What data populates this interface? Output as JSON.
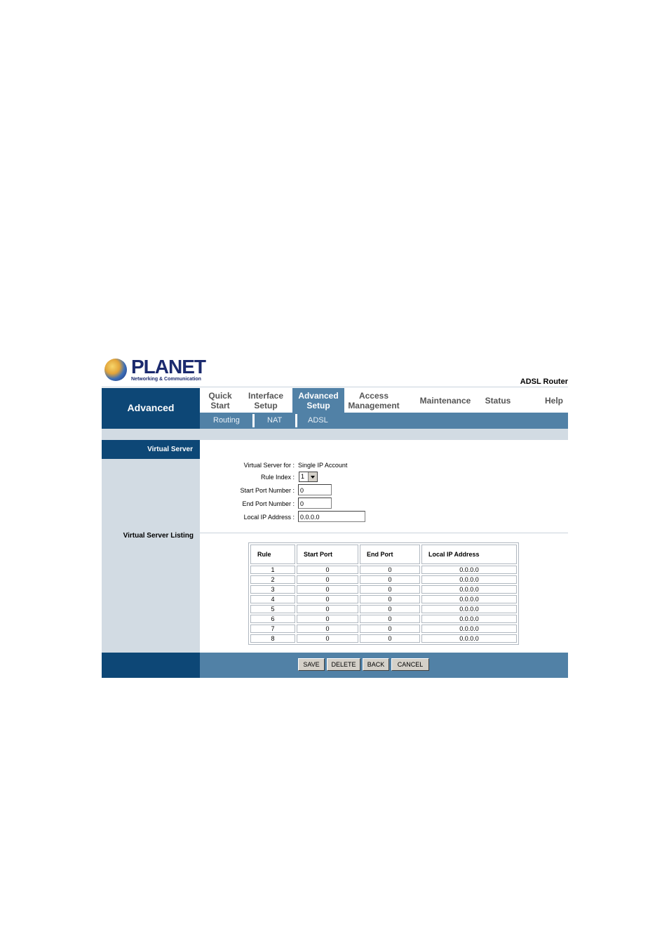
{
  "brand": {
    "logo_text": "PLANET",
    "tagline": "Networking & Communication",
    "model": "ADSL Router"
  },
  "section_title": "Advanced",
  "menu": [
    {
      "label": "Quick\nStart",
      "active": false
    },
    {
      "label": "Interface\nSetup",
      "active": false
    },
    {
      "label": "Advanced\nSetup",
      "active": true
    },
    {
      "label": "Access\nManagement",
      "active": false
    },
    {
      "label": "Maintenance",
      "active": false
    },
    {
      "label": "Status",
      "active": false
    },
    {
      "label": "Help",
      "active": false
    }
  ],
  "submenu": [
    "Routing",
    "NAT",
    "ADSL"
  ],
  "sidebar": {
    "virtual_server": "Virtual Server",
    "virtual_server_listing": "Virtual Server Listing"
  },
  "form": {
    "virtual_server_for_label": "Virtual Server for :",
    "virtual_server_for_value": "Single IP Account",
    "rule_index_label": "Rule Index :",
    "rule_index_value": "1",
    "start_port_label": "Start Port Number :",
    "start_port_value": "0",
    "end_port_label": "End Port Number :",
    "end_port_value": "0",
    "local_ip_label": "Local IP Address :",
    "local_ip_value": "0.0.0.0"
  },
  "table": {
    "headers": [
      "Rule",
      "Start Port",
      "End Port",
      "Local IP Address"
    ],
    "rows": [
      [
        "1",
        "0",
        "0",
        "0.0.0.0"
      ],
      [
        "2",
        "0",
        "0",
        "0.0.0.0"
      ],
      [
        "3",
        "0",
        "0",
        "0.0.0.0"
      ],
      [
        "4",
        "0",
        "0",
        "0.0.0.0"
      ],
      [
        "5",
        "0",
        "0",
        "0.0.0.0"
      ],
      [
        "6",
        "0",
        "0",
        "0.0.0.0"
      ],
      [
        "7",
        "0",
        "0",
        "0.0.0.0"
      ],
      [
        "8",
        "0",
        "0",
        "0.0.0.0"
      ]
    ]
  },
  "buttons": {
    "save": "SAVE",
    "delete": "DELETE",
    "back": "BACK",
    "cancel": "CANCEL"
  },
  "colors": {
    "navy": "#0d4776",
    "menu_active": "#5181a6",
    "light_gray_blue": "#d2dbe3"
  }
}
